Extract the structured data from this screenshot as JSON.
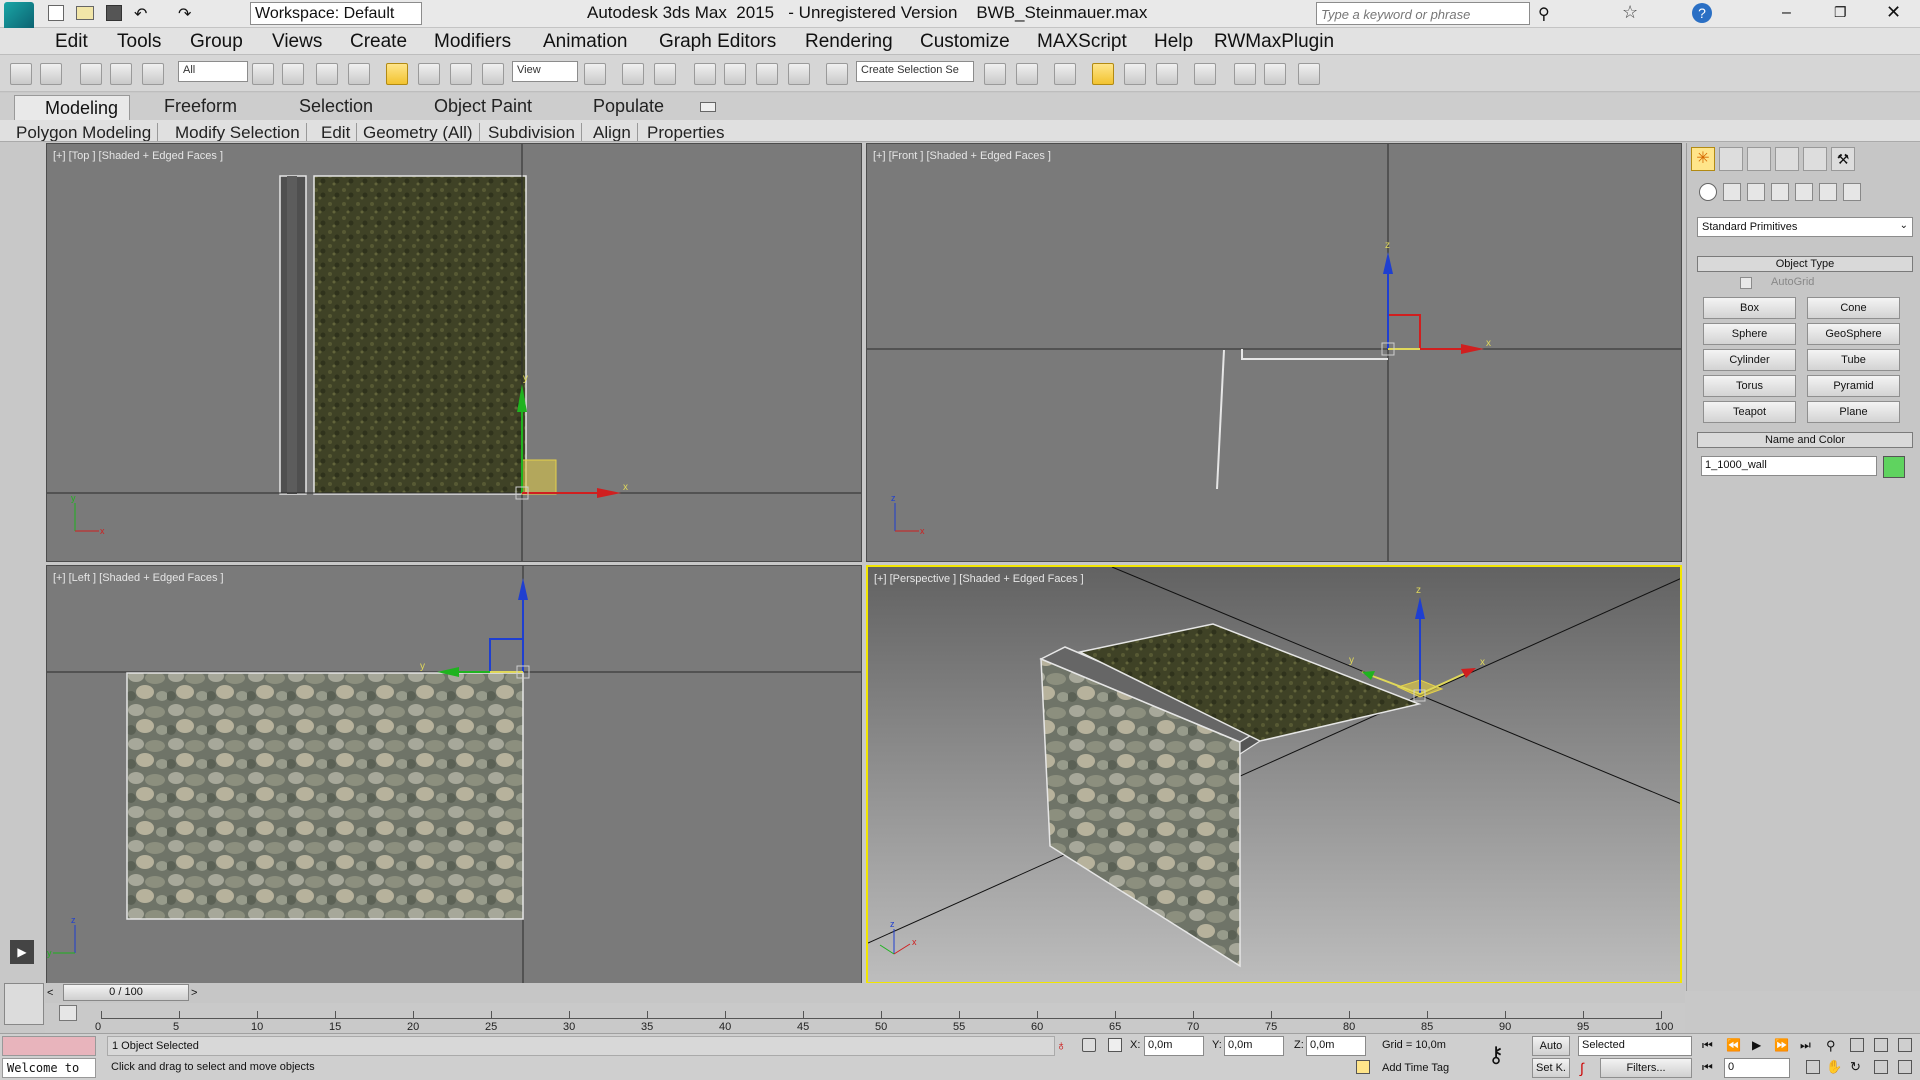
{
  "titlebar": {
    "workspace": "Workspace: Default",
    "title": "Autodesk 3ds Max  2015   - Unregistered Version    BWB_Steinmauer.max",
    "search_placeholder": "Type a keyword or phrase"
  },
  "menu": [
    "Edit",
    "Tools",
    "Group",
    "Views",
    "Create",
    "Modifiers",
    "Animation",
    "Graph Editors",
    "Rendering",
    "Customize",
    "MAXScript",
    "Help",
    "RWMaxPlugin"
  ],
  "toolbar": {
    "selection_filter": "All",
    "ref_coord": "View",
    "named_selection": "Create Selection Se"
  },
  "ribbon": {
    "tabs": [
      "Modeling",
      "Freeform",
      "Selection",
      "Object Paint",
      "Populate"
    ],
    "subtabs": [
      "Polygon Modeling",
      "Modify Selection",
      "Edit",
      "Geometry (All)",
      "Subdivision",
      "Align",
      "Properties"
    ]
  },
  "viewports": {
    "top": "[+] [Top ] [Shaded + Edged Faces ]",
    "front": "[+] [Front ] [Shaded + Edged Faces ]",
    "left": "[+] [Left ] [Shaded + Edged Faces ]",
    "perspective": "[+] [Perspective ] [Shaded + Edged Faces ]"
  },
  "axis": {
    "x": "x",
    "y": "y",
    "z": "z"
  },
  "cmdpanel": {
    "category": "Standard Primitives",
    "object_type": "Object Type",
    "autogrid": "AutoGrid",
    "buttons": [
      "Box",
      "Cone",
      "Sphere",
      "GeoSphere",
      "Cylinder",
      "Tube",
      "Torus",
      "Pyramid",
      "Teapot",
      "Plane"
    ],
    "name_color": "Name and Color",
    "object_name": "1_1000_wall",
    "object_color": "#5fd35f"
  },
  "timeline": {
    "frame": "0 / 100",
    "ticks": [
      "0",
      "5",
      "10",
      "15",
      "20",
      "25",
      "30",
      "35",
      "40",
      "45",
      "50",
      "55",
      "60",
      "65",
      "70",
      "75",
      "80",
      "85",
      "90",
      "95",
      "100"
    ]
  },
  "status": {
    "welcome": "Welcome to",
    "selection_info": "1 Object Selected",
    "prompt": "Click and drag to select and move objects",
    "x_label": "X:",
    "x_value": "0,0m",
    "y_label": "Y:",
    "y_value": "0,0m",
    "z_label": "Z:",
    "z_value": "0,0m",
    "grid": "Grid = 10,0m",
    "add_time_tag": "Add Time Tag",
    "auto": "Auto",
    "setk": "Set K.",
    "selected": "Selected",
    "filters": "Filters...",
    "frame_field": "0"
  }
}
